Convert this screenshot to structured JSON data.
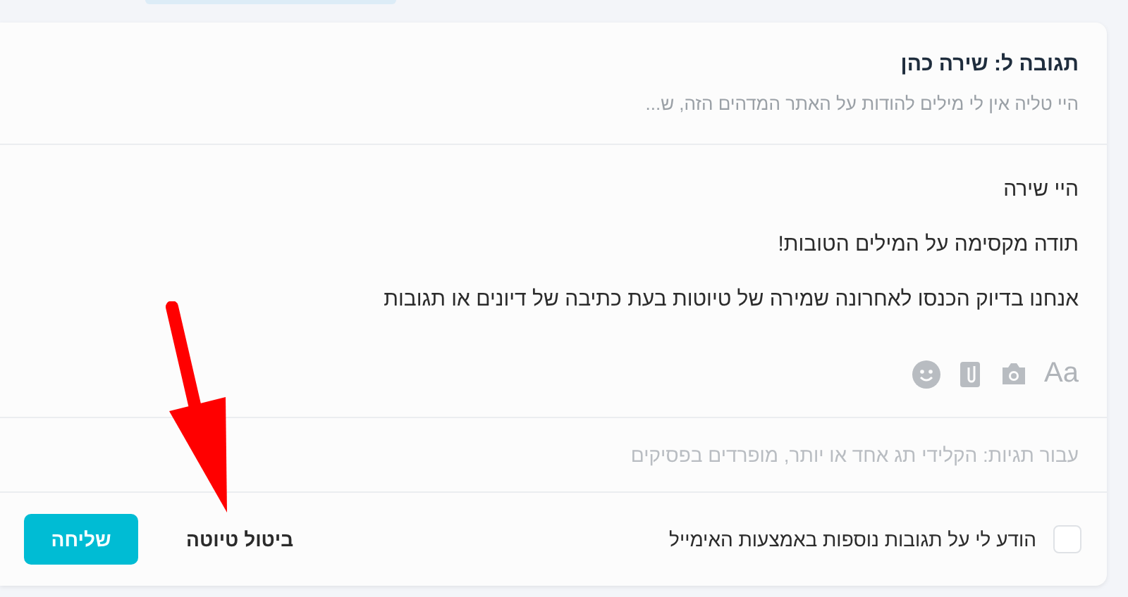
{
  "reply": {
    "title": "תגובה ל: שירה כהן",
    "preview": "היי טליה אין לי מילים להודות על האתר המדהים הזה, ש..."
  },
  "message": {
    "lines": [
      "היי שירה",
      "תודה מקסימה על המילים הטובות!",
      "אנחנו בדיוק הכנסו לאחרונה שמירה של טיוטות בעת כתיבה של דיונים או תגובות"
    ]
  },
  "toolbar": {
    "format_label": "Aa"
  },
  "tags": {
    "placeholder": "עבור תגיות: הקלידי תג אחד או יותר, מופרדים בפסיקים"
  },
  "notify": {
    "label": "הודע לי על תגובות נוספות באמצעות האימייל",
    "checked": false
  },
  "cancel": "ביטול טיוטה",
  "send": "שליחה"
}
